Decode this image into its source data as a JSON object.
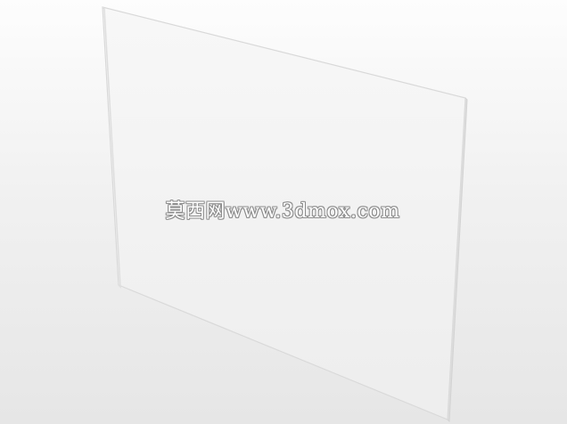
{
  "watermark": {
    "text": "莫西网www.3dmox.com"
  },
  "colors": {
    "background_top": "#fdfdfd",
    "background_bottom": "#e6e6e6",
    "panel_fill": "#f4f4f4",
    "panel_edge": "#d6d6d6",
    "watermark_fill": "#ffffff",
    "watermark_outline": "#8a8a8a"
  }
}
